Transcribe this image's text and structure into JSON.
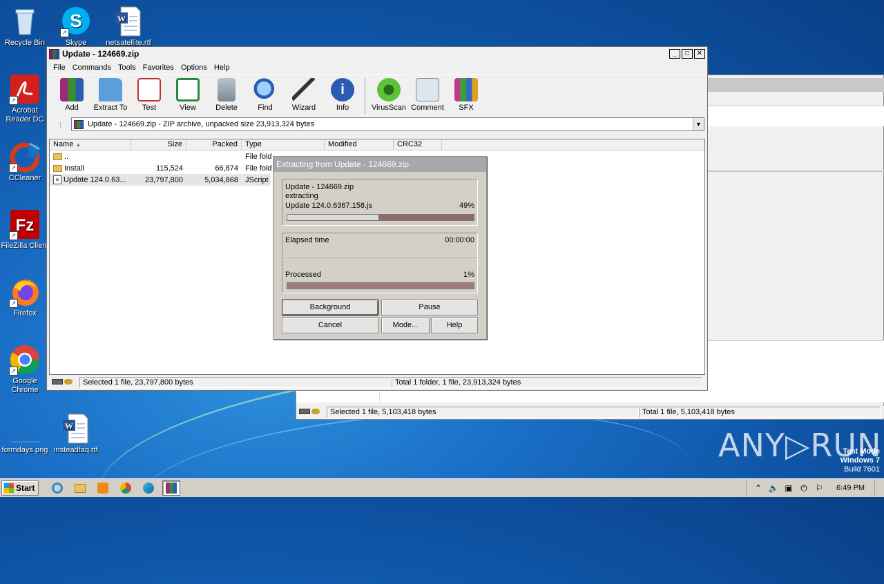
{
  "desktop": {
    "icons": [
      {
        "label": "Recycle Bin",
        "icon": "recycle-bin-icon"
      },
      {
        "label": "Skype",
        "icon": "skype-icon"
      },
      {
        "label": "netsatellite.rtf",
        "icon": "word-document-icon"
      },
      {
        "label": "Acrobat Reader DC",
        "icon": "acrobat-icon"
      },
      {
        "label": "CCleaner",
        "icon": "ccleaner-icon"
      },
      {
        "label": "FileZilla Client",
        "icon": "filezilla-icon"
      },
      {
        "label": "Firefox",
        "icon": "firefox-icon"
      },
      {
        "label": "Google Chrome",
        "icon": "chrome-icon"
      },
      {
        "label": "formdays.png",
        "icon": "image-file-icon"
      },
      {
        "label": "insteadfaq.rtf",
        "icon": "word-document-icon"
      }
    ]
  },
  "winrar": {
    "title": "Update - 124669.zip",
    "menu": [
      "File",
      "Commands",
      "Tools",
      "Favorites",
      "Options",
      "Help"
    ],
    "toolbar": [
      "Add",
      "Extract To",
      "Test",
      "View",
      "Delete",
      "Find",
      "Wizard",
      "Info",
      "VirusScan",
      "Comment",
      "SFX"
    ],
    "address": "Update - 124669.zip - ZIP archive, unpacked size 23,913,324 bytes",
    "columns": [
      "Name",
      "Size",
      "Packed",
      "Type",
      "Modified",
      "CRC32"
    ],
    "rows": [
      {
        "name": "..",
        "size": "",
        "packed": "",
        "type": "File fold"
      },
      {
        "name": "Install",
        "size": "115,524",
        "packed": "66,874",
        "type": "File fold"
      },
      {
        "name": "Update 124.0.63...",
        "size": "23,797,800",
        "packed": "5,034,868",
        "type": "JScript"
      }
    ],
    "status_left": "Selected 1 file, 23,797,800 bytes",
    "status_right": "Total 1 folder, 1 file, 23,913,324 bytes"
  },
  "back_window": {
    "status_left": "Selected 1 file, 5,103,418 bytes",
    "status_right": "Total 1 file, 5,103,418 bytes"
  },
  "dialog": {
    "title": "Extracting from Update - 124669.zip",
    "archive": "Update - 124669.zip",
    "action": "extracting",
    "file": "Update 124.0.6367.158.js",
    "file_percent": "49%",
    "file_progress": 0.49,
    "elapsed_label": "Elapsed time",
    "elapsed_value": "00:00:00",
    "processed_label": "Processed",
    "processed_percent": "1%",
    "processed_progress": 0.01,
    "buttons": {
      "background": "Background",
      "pause": "Pause",
      "cancel": "Cancel",
      "mode": "Mode...",
      "help": "Help"
    }
  },
  "taskbar": {
    "start": "Start",
    "clock": "6:49 PM"
  },
  "watermark": {
    "line1": "Test Mode",
    "line2": "Windows 7",
    "line3": "Build 7601",
    "anyrun": "ANY▷RUN"
  },
  "colors": {
    "progress_fill": "#8e6b6b",
    "desktop_blue": "#1a6fc6"
  }
}
